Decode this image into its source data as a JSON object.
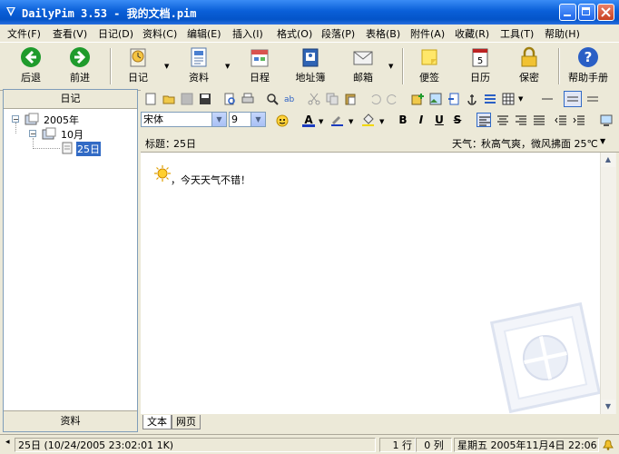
{
  "window": {
    "title": "DailyPim 3.53 - 我的文档.pim"
  },
  "menu": [
    "文件(F)",
    "查看(V)",
    "日记(D)",
    "资料(C)",
    "编辑(E)",
    "插入(I)",
    "格式(O)",
    "段落(P)",
    "表格(B)",
    "附件(A)",
    "收藏(R)",
    "工具(T)",
    "帮助(H)"
  ],
  "toolbar": {
    "back": "后退",
    "forward": "前进",
    "diary": "日记",
    "info": "资料",
    "schedule": "日程",
    "address_book": "地址簿",
    "mailbox": "邮箱",
    "sticky_note": "便签",
    "calendar": "日历",
    "lock": "保密",
    "help": "帮助手册"
  },
  "left_panel": {
    "header": "日记",
    "footer": "资料",
    "tree": {
      "year": "2005年",
      "month": "10月",
      "day": "25日"
    }
  },
  "format_bar": {
    "font": "宋体",
    "size": "9"
  },
  "entry": {
    "title_label": "标题：",
    "title_value": "25日",
    "weather_label": "天气：",
    "weather_value": "秋高气爽，微风拂面 25℃",
    "body": "，今天天气不错！"
  },
  "tabs": [
    "文本",
    "网页"
  ],
  "status": {
    "entry": "25日 (10/24/2005 23:02:01 1K)",
    "row": "1 行",
    "col": "0 列",
    "datetime": "星期五  2005年11月4日  22:06"
  },
  "colors": {
    "titlebar": "#0a5fd8",
    "selection": "#316ac5",
    "face": "#ece9d8"
  }
}
